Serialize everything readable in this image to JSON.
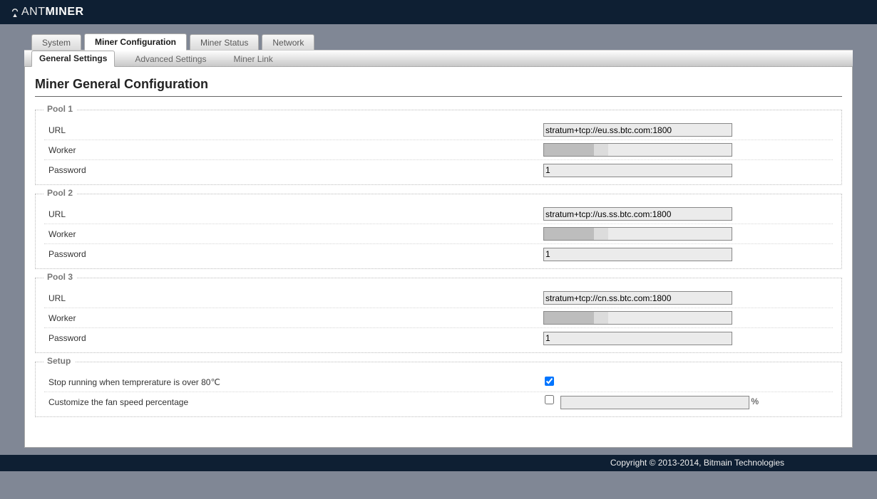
{
  "brand": {
    "ant": "ANT",
    "miner": "MINER"
  },
  "tabs": {
    "system": "System",
    "miner_config": "Miner Configuration",
    "miner_status": "Miner Status",
    "network": "Network"
  },
  "subtabs": {
    "general": "General Settings",
    "advanced": "Advanced Settings",
    "miner_link": "Miner Link"
  },
  "page_title": "Miner General Configuration",
  "labels": {
    "url": "URL",
    "worker": "Worker",
    "password": "Password"
  },
  "pools": [
    {
      "legend": "Pool 1",
      "url": "stratum+tcp://eu.ss.btc.com:1800",
      "worker": "",
      "password": "1"
    },
    {
      "legend": "Pool 2",
      "url": "stratum+tcp://us.ss.btc.com:1800",
      "worker": "",
      "password": "1"
    },
    {
      "legend": "Pool 3",
      "url": "stratum+tcp://cn.ss.btc.com:1800",
      "worker": "",
      "password": "1"
    }
  ],
  "setup": {
    "legend": "Setup",
    "stop_temp_label": "Stop running when temprerature is over 80℃",
    "stop_temp_checked": true,
    "fan_label": "Customize the fan speed percentage",
    "fan_checked": false,
    "fan_value": "",
    "fan_unit": "%"
  },
  "footer": "Copyright © 2013-2014, Bitmain Technologies"
}
